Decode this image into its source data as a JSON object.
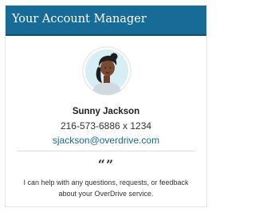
{
  "panel": {
    "title": "Your Account Manager"
  },
  "manager": {
    "name": "Sunny Jackson",
    "phone": "216-573-6886 x 1234",
    "email": "sjackson@overdrive.com",
    "avatar_icon": "woman-avatar-icon"
  },
  "quote": {
    "icon": "quote-icon",
    "glyph": "“”",
    "message": "I can help with any questions, requests, or feedback about your OverDrive service."
  },
  "colors": {
    "header_bg": "#166b97",
    "link": "#166b97",
    "avatar_bg": "#d7eef4",
    "skin": "#7a4a33",
    "hair": "#1f1f1f",
    "shirt": "#cfd9df"
  }
}
